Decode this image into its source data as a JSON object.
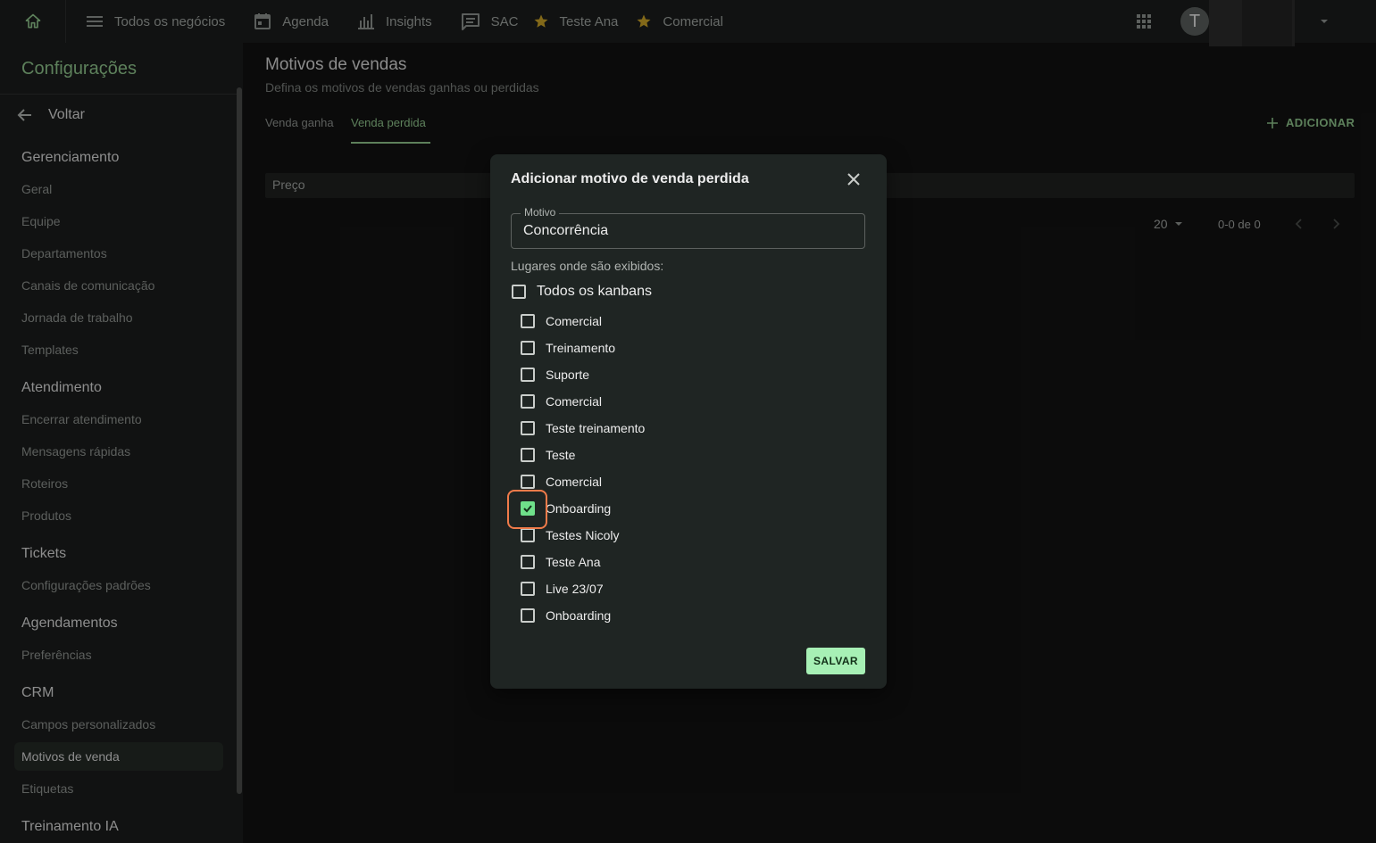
{
  "topbar": {
    "items": [
      {
        "label": "Todos os negócios",
        "icon": "menu-icon"
      },
      {
        "label": "Agenda",
        "icon": "calendar-icon"
      },
      {
        "label": "Insights",
        "icon": "bar-chart-icon"
      },
      {
        "label": "SAC",
        "icon": "chat-icon"
      },
      {
        "label": "Teste Ana",
        "icon": "star-icon"
      },
      {
        "label": "Comercial",
        "icon": "star-icon"
      }
    ],
    "avatar_initial": "T",
    "star_color": "#c9a227"
  },
  "sidebar": {
    "title": "Configurações",
    "back_label": "Voltar",
    "sections": [
      {
        "title": "Gerenciamento",
        "items": [
          "Geral",
          "Equipe",
          "Departamentos",
          "Canais de comunicação",
          "Jornada de trabalho",
          "Templates"
        ]
      },
      {
        "title": "Atendimento",
        "items": [
          "Encerrar atendimento",
          "Mensagens rápidas",
          "Roteiros",
          "Produtos"
        ]
      },
      {
        "title": "Tickets",
        "items": [
          "Configurações padrões"
        ]
      },
      {
        "title": "Agendamentos",
        "items": [
          "Preferências"
        ]
      },
      {
        "title": "CRM",
        "items": [
          "Campos personalizados",
          "Motivos de venda",
          "Etiquetas"
        ]
      },
      {
        "title": "Treinamento IA",
        "items": []
      }
    ],
    "active_item": "Motivos de venda"
  },
  "main": {
    "title": "Motivos de vendas",
    "subtitle": "Defina os motivos de vendas ganhas ou perdidas",
    "tabs": [
      {
        "label": "Venda ganha",
        "active": false
      },
      {
        "label": "Venda perdida",
        "active": true
      }
    ],
    "add_label": "ADICIONAR",
    "table": {
      "column": "Preço"
    },
    "pagination": {
      "per_page": "20",
      "range": "0-0 de 0"
    }
  },
  "modal": {
    "title": "Adicionar motivo de venda perdida",
    "field_label": "Motivo",
    "field_value": "Concorrência",
    "places_label": "Lugares onde são exibidos:",
    "all_label": "Todos os kanbans",
    "all_checked": false,
    "kanbans": [
      {
        "label": "Comercial",
        "checked": false
      },
      {
        "label": "Treinamento",
        "checked": false
      },
      {
        "label": "Suporte",
        "checked": false
      },
      {
        "label": "Comercial",
        "checked": false
      },
      {
        "label": "Teste treinamento",
        "checked": false
      },
      {
        "label": "Teste",
        "checked": false
      },
      {
        "label": "Comercial",
        "checked": false
      },
      {
        "label": "Onboarding",
        "checked": true
      },
      {
        "label": "Testes Nicoly",
        "checked": false
      },
      {
        "label": "Teste Ana",
        "checked": false
      },
      {
        "label": "Live 23/07",
        "checked": false
      },
      {
        "label": "Onboarding",
        "checked": false
      }
    ],
    "save_label": "SALVAR"
  },
  "colors": {
    "accent": "#8fc58c",
    "checkbox_checked": "#6fe08a",
    "highlight": "#f07b4a",
    "save_bg": "#a7f0b5"
  }
}
